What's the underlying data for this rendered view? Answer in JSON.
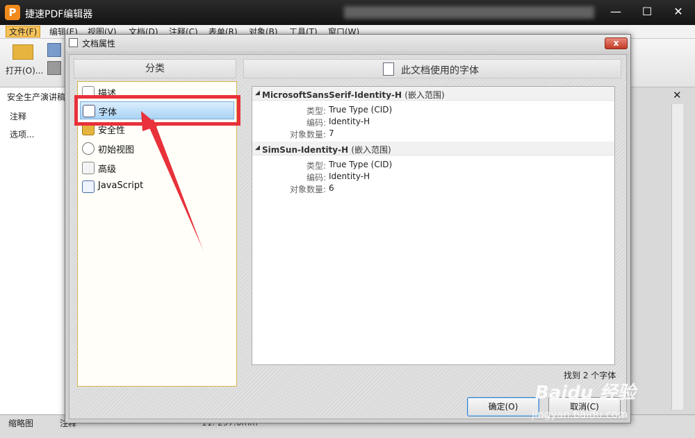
{
  "app": {
    "title": "捷速PDF编辑器",
    "logo_letter": "P",
    "menus": [
      "文件(F)",
      "编辑(E)",
      "视图(V)",
      "文档(D)",
      "注释(C)",
      "表单(R)",
      "对象(B)",
      "工具(T)",
      "窗口(W)"
    ],
    "ribbon_open_label": "打开(O)...",
    "doc_tab": "安全生产演讲稿",
    "panel_annotations": "注释",
    "panel_options": "选项...",
    "bottom_tab_thumbs": "缩略图",
    "bottom_tab_annot": "注释",
    "status_size": "11: 297.0mm"
  },
  "dialog": {
    "title": "文档属性",
    "close_label": "x",
    "category_header": "分类",
    "categories": [
      {
        "label": "描述",
        "icon": "info-icon"
      },
      {
        "label": "字体",
        "icon": "font-icon",
        "selected": true
      },
      {
        "label": "安全性",
        "icon": "lock-icon"
      },
      {
        "label": "初始视图",
        "icon": "magnifier-icon"
      },
      {
        "label": "高级",
        "icon": "gear-document-icon"
      },
      {
        "label": "JavaScript",
        "icon": "script-icon"
      }
    ],
    "fonts_header": "此文档使用的字体",
    "fonts": [
      {
        "name": "MicrosoftSansSerif-Identity-H",
        "embedded": "(嵌入范围)",
        "type_label": "类型:",
        "type": "True Type (CID)",
        "encoding_label": "编码:",
        "encoding": "Identity-H",
        "count_label": "对象数量:",
        "count": "7"
      },
      {
        "name": "SimSun-Identity-H",
        "embedded": "(嵌入范围)",
        "type_label": "类型:",
        "type": "True Type (CID)",
        "encoding_label": "编码:",
        "encoding": "Identity-H",
        "count_label": "对象数量:",
        "count": "6"
      }
    ],
    "found_text": "找到 2 个字体",
    "ok_label": "确定(O)",
    "cancel_label": "取消(C)"
  },
  "watermark": {
    "brand": "Baidu 经验",
    "url": "jingyan.baidu.com"
  },
  "colors": {
    "annotation_red": "#e8313a",
    "selection_blue": "#a9d3f5",
    "dark_titlebar": "#1a1a1a"
  }
}
